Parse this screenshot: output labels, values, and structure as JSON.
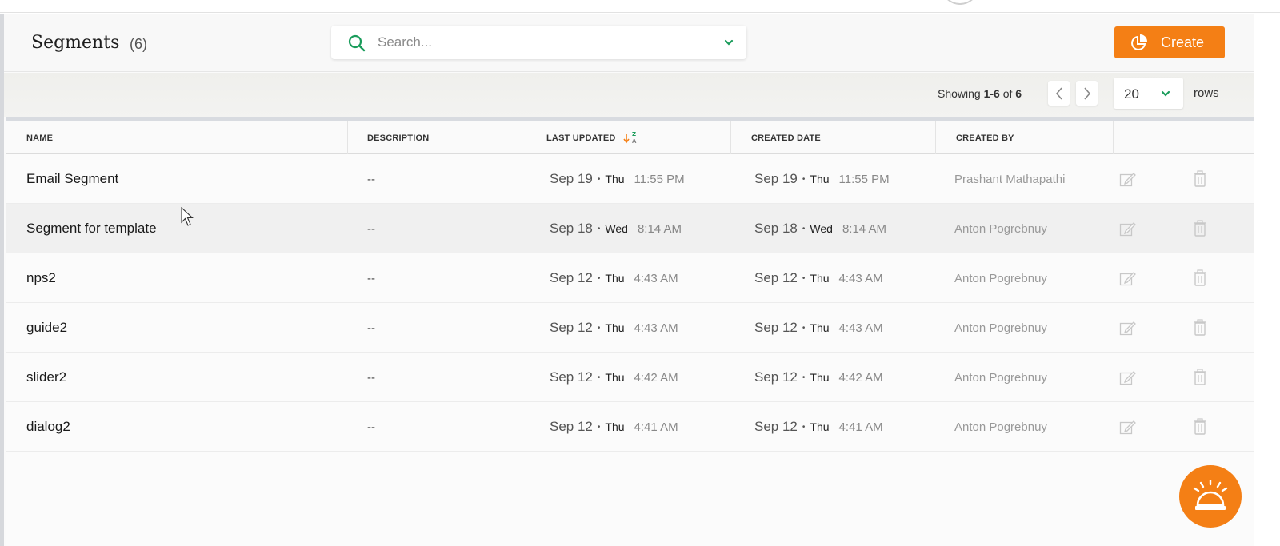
{
  "page": {
    "title": "Segments",
    "count": "(6)"
  },
  "search": {
    "placeholder": "Search...",
    "icon": "search-icon"
  },
  "create_button": {
    "label": "Create",
    "icon": "pie-chart-icon",
    "color": "#f47f15"
  },
  "pagination": {
    "showing_prefix": "Showing",
    "range": "1-6",
    "of_label": "of",
    "total": "6",
    "rows_per_page": "20",
    "rows_label": "rows"
  },
  "table": {
    "columns": [
      "NAME",
      "DESCRIPTION",
      "LAST UPDATED",
      "CREATED DATE",
      "CREATED BY"
    ],
    "sort": {
      "column": "LAST UPDATED",
      "icon": "sort-desc-z-a-icon"
    },
    "rows": [
      {
        "name": "Email Segment",
        "description": "--",
        "updated_date": "Sep 19",
        "updated_day": "Thu",
        "updated_time": "11:55 PM",
        "created_date": "Sep 19",
        "created_day": "Thu",
        "created_time": "11:55 PM",
        "created_by": "Prashant Mathapathi"
      },
      {
        "name": "Segment for template",
        "description": "--",
        "updated_date": "Sep 18",
        "updated_day": "Wed",
        "updated_time": "8:14 AM",
        "created_date": "Sep 18",
        "created_day": "Wed",
        "created_time": "8:14 AM",
        "created_by": "Anton Pogrebnuy"
      },
      {
        "name": "nps2",
        "description": "--",
        "updated_date": "Sep 12",
        "updated_day": "Thu",
        "updated_time": "4:43 AM",
        "created_date": "Sep 12",
        "created_day": "Thu",
        "created_time": "4:43 AM",
        "created_by": "Anton Pogrebnuy"
      },
      {
        "name": "guide2",
        "description": "--",
        "updated_date": "Sep 12",
        "updated_day": "Thu",
        "updated_time": "4:43 AM",
        "created_date": "Sep 12",
        "created_day": "Thu",
        "created_time": "4:43 AM",
        "created_by": "Anton Pogrebnuy"
      },
      {
        "name": "slider2",
        "description": "--",
        "updated_date": "Sep 12",
        "updated_day": "Thu",
        "updated_time": "4:42 AM",
        "created_date": "Sep 12",
        "created_day": "Thu",
        "created_time": "4:42 AM",
        "created_by": "Anton Pogrebnuy"
      },
      {
        "name": "dialog2",
        "description": "--",
        "updated_date": "Sep 12",
        "updated_day": "Thu",
        "updated_time": "4:41 AM",
        "created_date": "Sep 12",
        "created_day": "Thu",
        "created_time": "4:41 AM",
        "created_by": "Anton Pogrebnuy"
      }
    ],
    "row_actions": [
      "edit-icon",
      "trash-icon"
    ]
  },
  "help_button": {
    "icon": "service-bell-icon"
  },
  "colors": {
    "accent": "#f47f15",
    "search_icon": "#1a9c5b"
  }
}
